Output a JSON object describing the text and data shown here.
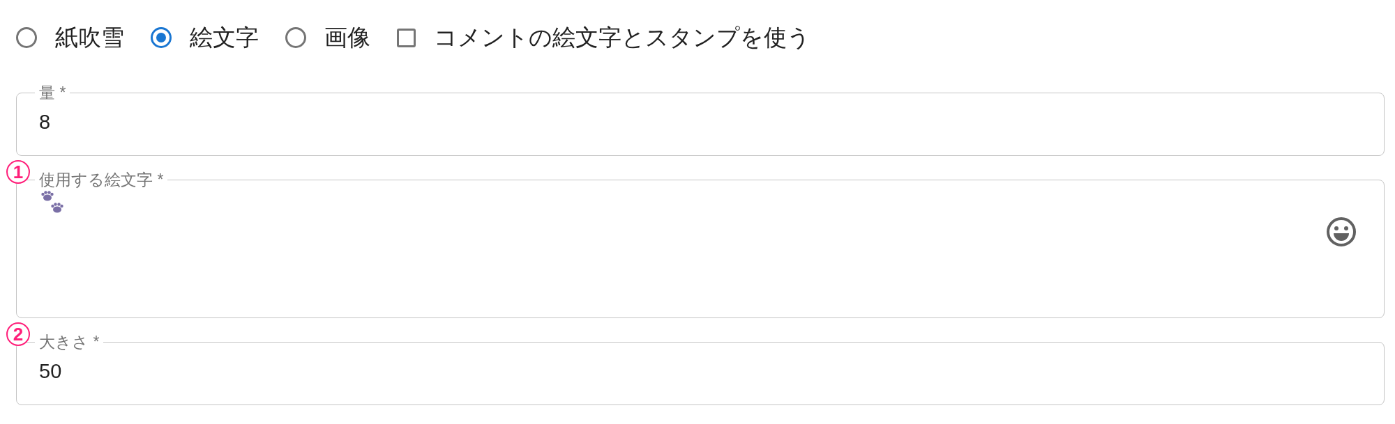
{
  "options": [
    {
      "kind": "radio",
      "label": "紙吹雪",
      "selected": false
    },
    {
      "kind": "radio",
      "label": "絵文字",
      "selected": true
    },
    {
      "kind": "radio",
      "label": "画像",
      "selected": false
    },
    {
      "kind": "checkbox",
      "label": "コメントの絵文字とスタンプを使う",
      "checked": false
    }
  ],
  "fields": [
    {
      "kind": "number",
      "label": "量 *",
      "value": "8"
    },
    {
      "kind": "emoji",
      "label": "使用する絵文字 *",
      "marker": "1"
    },
    {
      "kind": "number",
      "label": "大きさ *",
      "value": "50",
      "marker": "2"
    }
  ]
}
